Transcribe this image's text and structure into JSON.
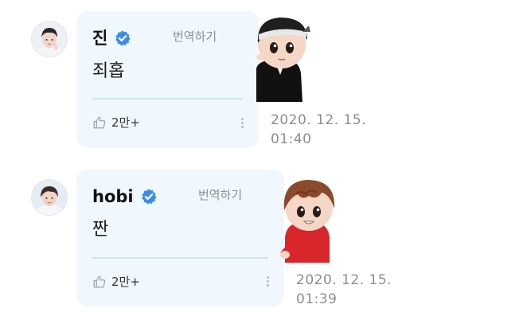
{
  "messages": [
    {
      "author": "진",
      "verified": true,
      "translate_label": "번역하기",
      "text": "죄홉",
      "likes": "2만+",
      "timestamp_date": "2020. 12. 15.",
      "timestamp_time": "01:40",
      "sticker": "jin-character-sticker"
    },
    {
      "author": "hobi",
      "verified": true,
      "translate_label": "번역하기",
      "text": "짠",
      "likes": "2만+",
      "timestamp_date": "2020. 12. 15.",
      "timestamp_time": "01:39",
      "sticker": "hobi-character-sticker"
    }
  ],
  "colors": {
    "bubble_bg": "#f1f8fd",
    "verified_badge": "#3c8ce7",
    "divider": "#c9e6ef",
    "muted_text": "#8d8d8d"
  },
  "icons": [
    "verified-badge-icon",
    "thumbs-up-icon",
    "more-options-icon"
  ]
}
